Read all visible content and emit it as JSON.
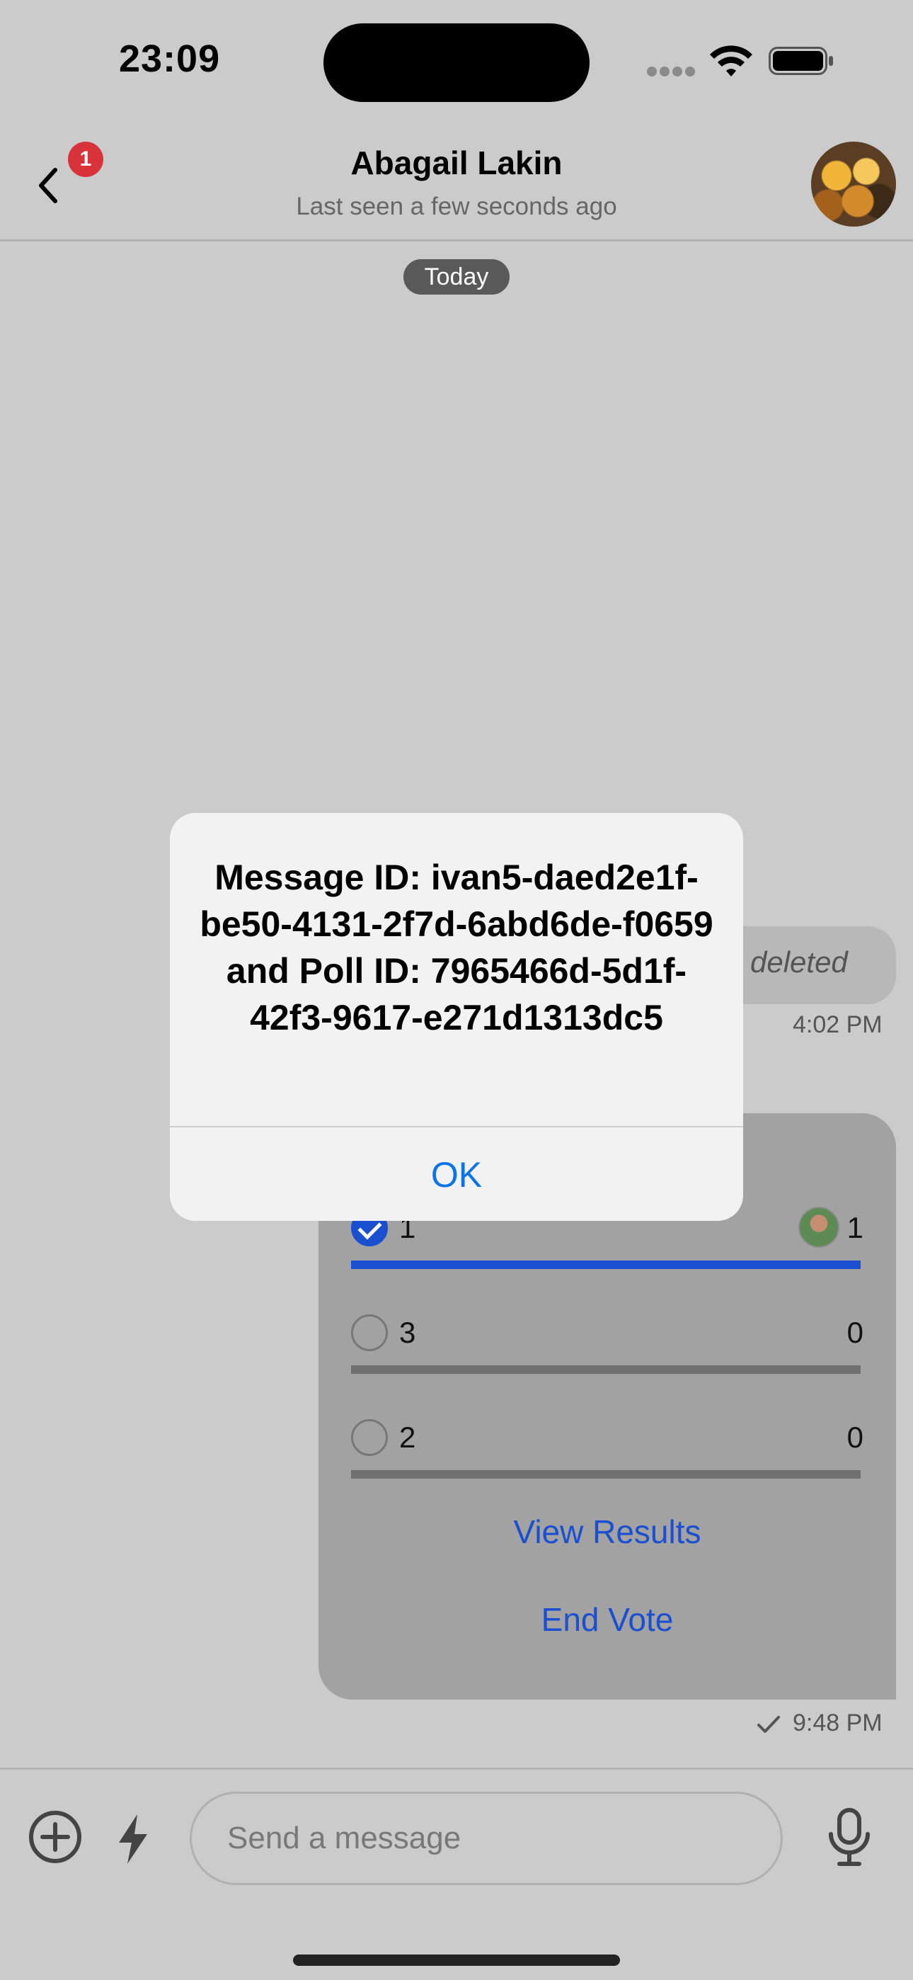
{
  "status_bar": {
    "time": "23:09"
  },
  "header": {
    "back_badge": "1",
    "title": "Abagail Lakin",
    "subtitle": "Last seen a few seconds ago"
  },
  "chat": {
    "date_separator": "Today",
    "deleted_message": {
      "text": "deleted",
      "time": "4:02 PM"
    },
    "poll": {
      "options": [
        {
          "label": "1",
          "count": "1",
          "selected": true
        },
        {
          "label": "3",
          "count": "0",
          "selected": false
        },
        {
          "label": "2",
          "count": "0",
          "selected": false
        }
      ],
      "view_results_label": "View Results",
      "end_vote_label": "End Vote",
      "time": "9:48 PM"
    }
  },
  "composer": {
    "placeholder": "Send a message"
  },
  "alert": {
    "message": "Message ID: ivan5-daed2e1f-be50-4131-2f7d-6abd6de-f0659 and Poll ID: 7965466d-5d1f-42f3-9617-e271d1313dc5",
    "ok_label": "OK"
  },
  "colors": {
    "accent_blue": "#1a4fd0",
    "alert_button_blue": "#0a74e8",
    "badge_red": "#d8333a"
  }
}
